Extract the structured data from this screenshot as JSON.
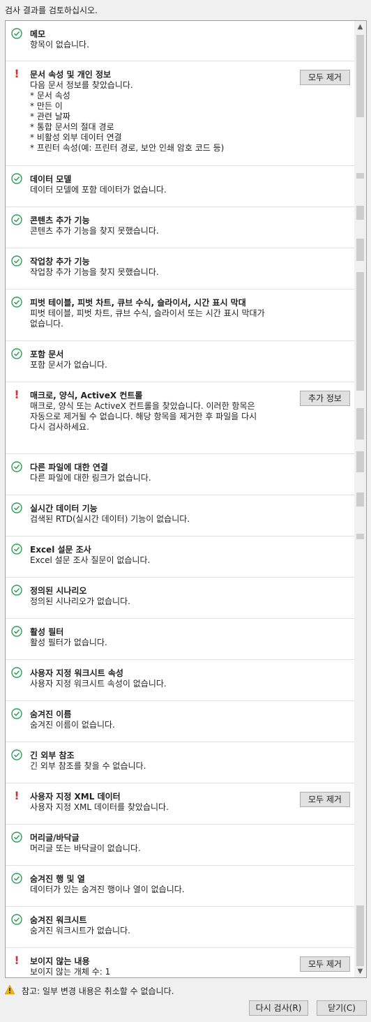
{
  "header": {
    "instruction": "검사 결과를 검토하십시오."
  },
  "items": [
    {
      "status": "ok",
      "title": "메모",
      "lines": [
        "항목이 없습니다."
      ],
      "button": null
    },
    {
      "status": "warn",
      "title": "문서 속성 및 개인 정보",
      "lines": [
        "다음 문서 정보를 찾았습니다.",
        "* 문서 속성",
        "* 만든 이",
        "* 관련 날짜",
        "* 통합 문서의 절대 경로",
        "* 비활성 외부 데이터 연결",
        "* 프린터 속성(예: 프린터 경로, 보안 인쇄 암호 코드 등)"
      ],
      "button": "모두 제거"
    },
    {
      "status": "ok",
      "title": "데이터 모델",
      "lines": [
        "데이터 모델에 포함 데이터가 없습니다."
      ],
      "button": null
    },
    {
      "status": "ok",
      "title": "콘텐츠 추가 기능",
      "lines": [
        "콘텐츠 추가 기능을 찾지 못했습니다."
      ],
      "button": null
    },
    {
      "status": "ok",
      "title": "작업창 추가 기능",
      "lines": [
        "작업창 추가 기능을 찾지 못했습니다."
      ],
      "button": null
    },
    {
      "status": "ok",
      "title": "피벗 테이블, 피벗 차트, 큐브 수식, 슬라이서, 시간 표시 막대",
      "lines": [
        "피벗 테이블, 피벗 차트, 큐브 수식, 슬라이서 또는 시간 표시 막대가",
        "없습니다."
      ],
      "button": null
    },
    {
      "status": "ok",
      "title": "포함 문서",
      "lines": [
        "포함 문서가 없습니다."
      ],
      "button": null
    },
    {
      "status": "warn",
      "title": "매크로, 양식, ActiveX 컨트롤",
      "lines": [
        "매크로, 양식 또는 ActiveX 컨트롤을 찾았습니다. 이러한 항목은",
        "자동으로 제거될 수 없습니다. 해당 항목을 제거한 후 파일을 다시",
        "다시 검사하세요."
      ],
      "button": "추가 정보"
    },
    {
      "status": "ok",
      "title": "다른 파일에 대한 연결",
      "lines": [
        "다른 파일에 대한 링크가 없습니다."
      ],
      "button": null
    },
    {
      "status": "ok",
      "title": "실시간 데이터 기능",
      "lines": [
        "검색된 RTD(실시간 데이터) 기능이 없습니다."
      ],
      "button": null
    },
    {
      "status": "ok",
      "title": "Excel 설문 조사",
      "lines": [
        "Excel 설문 조사 질문이 없습니다."
      ],
      "button": null
    },
    {
      "status": "ok",
      "title": "정의된 시나리오",
      "lines": [
        "정의된 시나리오가 없습니다."
      ],
      "button": null
    },
    {
      "status": "ok",
      "title": "활성 필터",
      "lines": [
        "활성 필터가 없습니다."
      ],
      "button": null
    },
    {
      "status": "ok",
      "title": "사용자 지정 워크시트 속성",
      "lines": [
        "사용자 지정 워크시트 속성이 없습니다."
      ],
      "button": null
    },
    {
      "status": "ok",
      "title": "숨겨진 이름",
      "lines": [
        "숨겨진 이름이 없습니다."
      ],
      "button": null
    },
    {
      "status": "ok",
      "title": "긴 외부 참조",
      "lines": [
        "긴 외부 참조를 찾을 수 없습니다."
      ],
      "button": null
    },
    {
      "status": "warn",
      "title": "사용자 지정 XML 데이터",
      "lines": [
        "사용자 지정 XML 데이터를 찾았습니다."
      ],
      "button": "모두 제거"
    },
    {
      "status": "ok",
      "title": "머리글/바닥글",
      "lines": [
        "머리글 또는 바닥글이 없습니다."
      ],
      "button": null
    },
    {
      "status": "ok",
      "title": "숨겨진 행 및 열",
      "lines": [
        "데이터가 있는 숨겨진 행이나 열이 없습니다."
      ],
      "button": null
    },
    {
      "status": "ok",
      "title": "숨겨진 워크시트",
      "lines": [
        "숨겨진 워크시트가 없습니다."
      ],
      "button": null
    },
    {
      "status": "warn",
      "title": "보이지 않는 내용",
      "lines": [
        "보이지 않는 개체 수: 1"
      ],
      "button": "모두 제거"
    }
  ],
  "footer": {
    "warning": "참고: 일부 변경 내용은 취소할 수 없습니다.",
    "reinspect_label": "다시 검사(R)",
    "close_label": "닫기(C)"
  },
  "colors": {
    "ok": "#2e9e5b",
    "warn": "#d13438"
  }
}
